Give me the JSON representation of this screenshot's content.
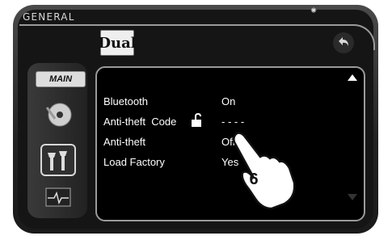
{
  "header": {
    "title": "GENERAL",
    "logo": "Dual",
    "status_icon": "bluetooth-icon",
    "back_icon": "back-arrow-icon"
  },
  "sidebar": {
    "main_label": "MAIN",
    "items": [
      {
        "icon": "disc-dvd-icon"
      },
      {
        "icon": "settings-tools-icon",
        "selected": true
      },
      {
        "icon": "waveform-monitor-icon"
      }
    ]
  },
  "settings": [
    {
      "label": "Bluetooth",
      "value": "On"
    },
    {
      "label": "Anti-theft  Code",
      "value": "- - - -",
      "icon": "padlock-unlocked-icon"
    },
    {
      "label": "Anti-theft",
      "value": "Off"
    },
    {
      "label": "Load Factory",
      "value": "Yes"
    }
  ],
  "callout": {
    "step_number": "6",
    "icon": "pointing-hand-icon"
  }
}
